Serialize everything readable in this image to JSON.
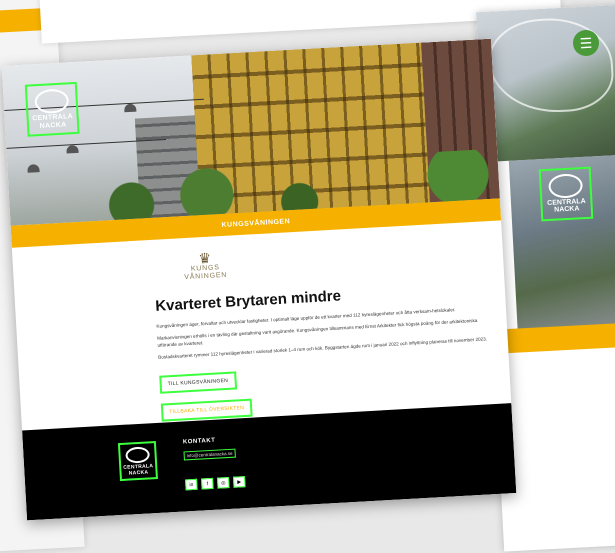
{
  "site": {
    "logo_line1": "CENTRALA",
    "logo_line2": "NACKA"
  },
  "header": {
    "section_bar": "KUNGSVÅNINGEN",
    "menu_icon": "menu-icon"
  },
  "brand": {
    "name_line1": "KUNGS",
    "name_line2": "VÅNINGEN",
    "icon": "crown-icon"
  },
  "article": {
    "title": "Kvarteret Brytaren mindre",
    "para1": "Kungsvåningen äger, förvaltar och utvecklar fastigheter. I optimalt läge uppför de ett kvarter med 112 hyreslägenheter och åtta verksam-hetslokaler.",
    "para2": "Markanvisningen erhölls i en tävling där gestaltning varit avgörande. Kungsvåningen tillsammans med Ernst Arkitekter fick högsta poäng för der arkitektoniska utförande av kvarteret.",
    "para3": "Bostadskvarteret rymmer 112 hyreslägenheter i varierad storlek 1–4 rum och kök. Byggstarten ägde rum i januari 2022 och inflyttning planeras till november 2023.",
    "btn_primary": "TILL KUNGSVÅNINGEN",
    "btn_secondary": "TILLBAKA TILL ÖVERSIKTEN"
  },
  "footer": {
    "contact_heading": "KONTAKT",
    "contact_email": "info@centralanacka.se",
    "socials": [
      "in",
      "f",
      "◎",
      "▶"
    ]
  },
  "colors": {
    "accent_yellow": "#f5b000",
    "footer_bg": "#000000",
    "highlight_green": "#3dff3d"
  }
}
